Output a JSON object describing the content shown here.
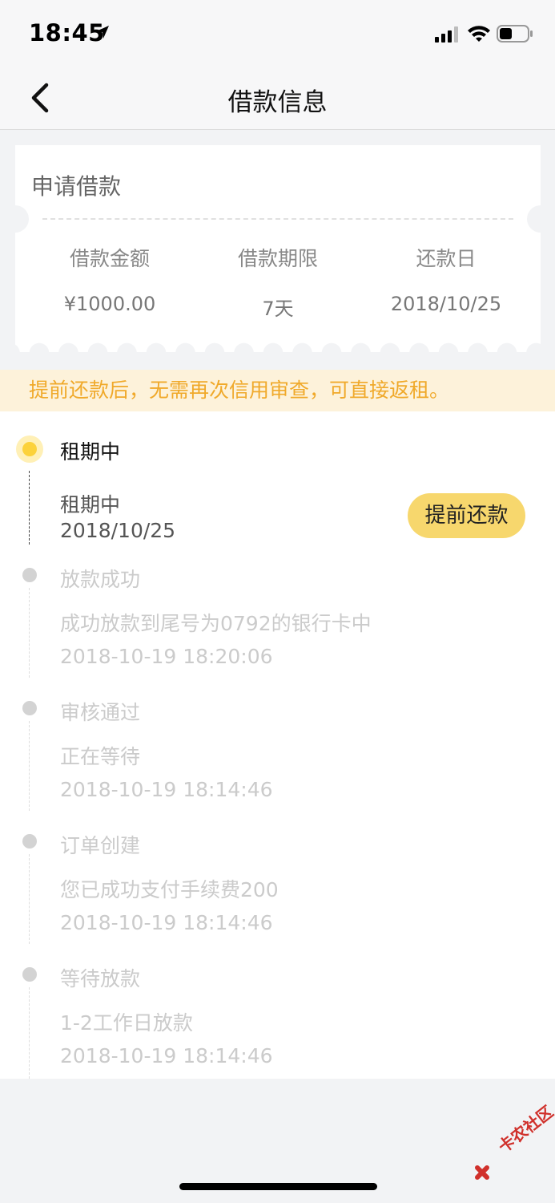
{
  "status_bar": {
    "time": "18:45"
  },
  "nav": {
    "title": "借款信息"
  },
  "loan_card": {
    "header": "申请借款",
    "columns": [
      {
        "label": "借款金额",
        "value": "¥1000.00"
      },
      {
        "label": "借款期限",
        "value": "7天"
      },
      {
        "label": "还款日",
        "value": "2018/10/25"
      }
    ]
  },
  "notice": "提前还款后，无需再次信用审查，可直接返租。",
  "timeline": [
    {
      "title": "租期中",
      "desc": "租期中",
      "time": "2018/10/25",
      "active": true
    },
    {
      "title": "放款成功",
      "desc": "成功放款到尾号为0792的银行卡中",
      "time": "2018-10-19 18:20:06",
      "active": false
    },
    {
      "title": "审核通过",
      "desc": "正在等待",
      "time": "2018-10-19 18:14:46",
      "active": false
    },
    {
      "title": "订单创建",
      "desc": "您已成功支付手续费200",
      "time": "2018-10-19 18:14:46",
      "active": false
    },
    {
      "title": "等待放款",
      "desc": "1-2工作日放款",
      "time": "2018-10-19 18:14:46",
      "active": false
    }
  ],
  "repay_button": "提前还款",
  "watermark": "卡农社区",
  "colors": {
    "accent": "#fcd23a",
    "button": "#f7d76d",
    "notice_text": "#f0a92a",
    "notice_bg": "#fdf2da"
  }
}
